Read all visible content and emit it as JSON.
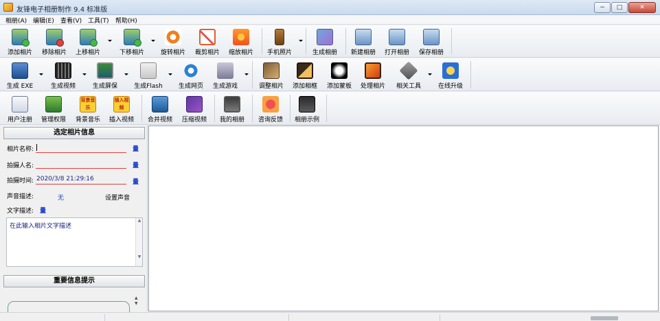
{
  "window": {
    "title": "友锋电子相册制作 9.4 标准版",
    "buttons": {
      "minimize": "−",
      "maximize": "□",
      "close": "✕"
    }
  },
  "menu": [
    {
      "label": "相册(A)"
    },
    {
      "label": "编辑(E)"
    },
    {
      "label": "查看(V)"
    },
    {
      "label": "工具(T)"
    },
    {
      "label": "帮助(H)"
    }
  ],
  "toolbar1": [
    {
      "label": "添加相片",
      "icon": "add-photo-icon"
    },
    {
      "label": "移除相片",
      "icon": "remove-photo-icon"
    },
    {
      "label": "上移相片",
      "icon": "move-up-icon"
    },
    {
      "label": "下移相片",
      "icon": "move-down-icon"
    },
    {
      "label": "旋转相片",
      "icon": "rotate-icon"
    },
    {
      "label": "裁剪相片",
      "icon": "crop-icon"
    },
    {
      "label": "缩放相片",
      "icon": "scale-icon"
    },
    {
      "label": "手机照片",
      "icon": "phone-icon"
    },
    {
      "label": "生成相册",
      "icon": "build-album-icon"
    },
    {
      "label": "新建相册",
      "icon": "new-album-icon"
    },
    {
      "label": "打开相册",
      "icon": "open-album-icon"
    },
    {
      "label": "保存相册",
      "icon": "save-album-icon"
    }
  ],
  "toolbar2": [
    {
      "label": "生成 EXE",
      "icon": "exe-icon"
    },
    {
      "label": "生成视频",
      "icon": "film-icon"
    },
    {
      "label": "生成屏保",
      "icon": "screensaver-icon"
    },
    {
      "label": "生成Flash",
      "icon": "flash-icon"
    },
    {
      "label": "生成网页",
      "icon": "web-icon"
    },
    {
      "label": "生成游戏",
      "icon": "game-icon"
    },
    {
      "label": "调整相片",
      "icon": "adjust-icon"
    },
    {
      "label": "添加相框",
      "icon": "frame-icon"
    },
    {
      "label": "添加蒙板",
      "icon": "mask-icon"
    },
    {
      "label": "处理相片",
      "icon": "process-icon"
    },
    {
      "label": "相关工具",
      "icon": "tools-icon"
    },
    {
      "label": "在线升级",
      "icon": "upgrade-icon"
    }
  ],
  "toolbar3": [
    {
      "label": "用户注册",
      "icon": "register-icon"
    },
    {
      "label": "管理权限",
      "icon": "shield-icon"
    },
    {
      "label": "背景音乐",
      "icon": "music-icon",
      "badge": "背景音乐"
    },
    {
      "label": "插入视频",
      "icon": "video-icon",
      "badge": "插入视频"
    },
    {
      "label": "合并视频",
      "icon": "merge-icon"
    },
    {
      "label": "压缩视频",
      "icon": "compress-icon"
    },
    {
      "label": "我的相册",
      "icon": "my-album-icon"
    },
    {
      "label": "咨询反馈",
      "icon": "feedback-icon"
    },
    {
      "label": "相册示例",
      "icon": "examples-icon"
    }
  ],
  "photo_info": {
    "header": "选定相片信息",
    "name_label": "相片名称:",
    "name_value": "",
    "author_label": "拍摄人名:",
    "author_value": "",
    "time_label": "拍摄时间:",
    "time_value": "2020/3/8 21:29:16",
    "mic_label": "量",
    "voice_label": "声音描述:",
    "voice_value": "无",
    "set_voice": "设置声音",
    "text_label": "文字描述:",
    "desc_placeholder": "在此输入相片文字描述"
  },
  "tips": {
    "header": "重要信息提示"
  },
  "colors": {
    "accent_red": "#e04040",
    "link_blue": "#1a3cc8",
    "text_navy": "#1a237e"
  }
}
